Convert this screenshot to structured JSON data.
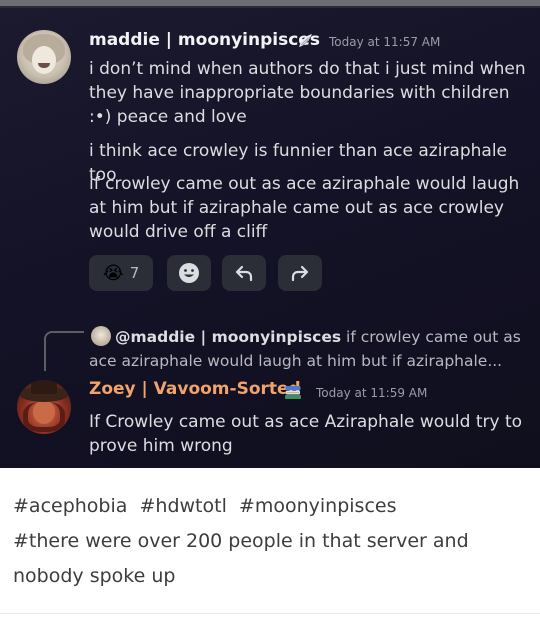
{
  "post": {
    "messages": [
      {
        "author": "maddie | moonyinpisces",
        "badge_icon": "wing-icon",
        "timestamp": "Today at 11:57 AM",
        "lines": [
          "i don’t mind when authors do that i just mind when they have inappropriate boundaries with children :•) peace and love",
          "i think ace crowley is funnier than ace aziraphale too",
          "if crowley came out as ace aziraphale would laugh at him but if aziraphale came out as ace crowley would drive off a cliff"
        ],
        "reactions": [
          {
            "icon": "crying-face-emoji",
            "glyph": "😭",
            "count": "7"
          }
        ],
        "actions": [
          "add-reaction-icon",
          "reply-icon",
          "forward-icon"
        ]
      },
      {
        "reply_to": {
          "mention": "@maddie | moonyinpisces",
          "snippet": "if crowley came out as ace aziraphale would laugh at him but if aziraphale..."
        },
        "author": "Zoey | Vavoom-Sorted",
        "badge_icon": "books-icon",
        "timestamp": "Today at 11:59 AM",
        "lines": [
          "If Crowley came out as ace Aziraphale would try to prove him wrong"
        ]
      }
    ],
    "tags_line1": "#acephobia  #hdwtotl  #moonyinpisces",
    "tags_line2": "#there were over 200 people in that server and nobody spoke up"
  },
  "colors": {
    "background": "#141227",
    "author_maddie": "#f2f3f5",
    "author_zoey": "#f0a36b",
    "text": "#dbdee1",
    "muted": "#9a9ca6",
    "reaction_bg": "#2b2d37"
  }
}
